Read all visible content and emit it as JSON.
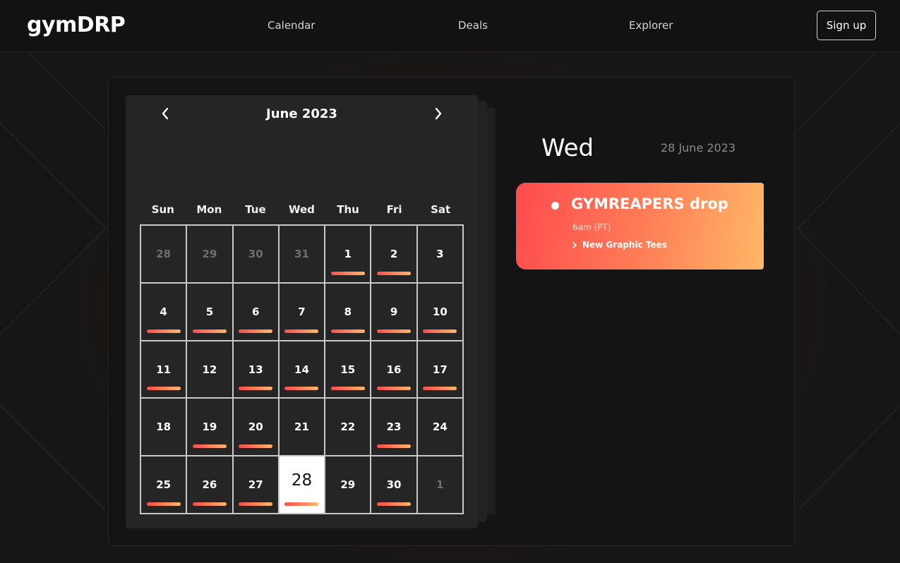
{
  "nav": {
    "logo": "gymDRP",
    "links": [
      "Calendar",
      "Deals",
      "Explorer"
    ],
    "signup_label": "Sign up"
  },
  "calendar": {
    "month_title": "June 2023",
    "weekdays": [
      "Sun",
      "Mon",
      "Tue",
      "Wed",
      "Thu",
      "Fri",
      "Sat"
    ],
    "weeks": [
      [
        {
          "d": "28",
          "out": true
        },
        {
          "d": "29",
          "out": true
        },
        {
          "d": "30",
          "out": true
        },
        {
          "d": "31",
          "out": true
        },
        {
          "d": "1",
          "ev": true
        },
        {
          "d": "2",
          "ev": true
        },
        {
          "d": "3"
        }
      ],
      [
        {
          "d": "4",
          "ev": true
        },
        {
          "d": "5",
          "ev": true
        },
        {
          "d": "6",
          "ev": true
        },
        {
          "d": "7",
          "ev": true
        },
        {
          "d": "8",
          "ev": true
        },
        {
          "d": "9",
          "ev": true
        },
        {
          "d": "10",
          "ev": true
        }
      ],
      [
        {
          "d": "11",
          "ev": true
        },
        {
          "d": "12"
        },
        {
          "d": "13",
          "ev": true
        },
        {
          "d": "14",
          "ev": true
        },
        {
          "d": "15",
          "ev": true
        },
        {
          "d": "16",
          "ev": true
        },
        {
          "d": "17",
          "ev": true
        }
      ],
      [
        {
          "d": "18"
        },
        {
          "d": "19",
          "ev": true
        },
        {
          "d": "20",
          "ev": true
        },
        {
          "d": "21"
        },
        {
          "d": "22"
        },
        {
          "d": "23",
          "ev": true
        },
        {
          "d": "24"
        }
      ],
      [
        {
          "d": "25",
          "ev": true
        },
        {
          "d": "26",
          "ev": true
        },
        {
          "d": "27",
          "ev": true
        },
        {
          "d": "28",
          "ev": true,
          "selected": true
        },
        {
          "d": "29"
        },
        {
          "d": "30",
          "ev": true
        },
        {
          "d": "1",
          "out": true
        }
      ]
    ]
  },
  "day_panel": {
    "day_name": "Wed",
    "date": "28 June 2023",
    "event": {
      "title": "GYMREAPERS drop",
      "time": "6am (PT)",
      "link": "New Graphic Tees"
    }
  }
}
